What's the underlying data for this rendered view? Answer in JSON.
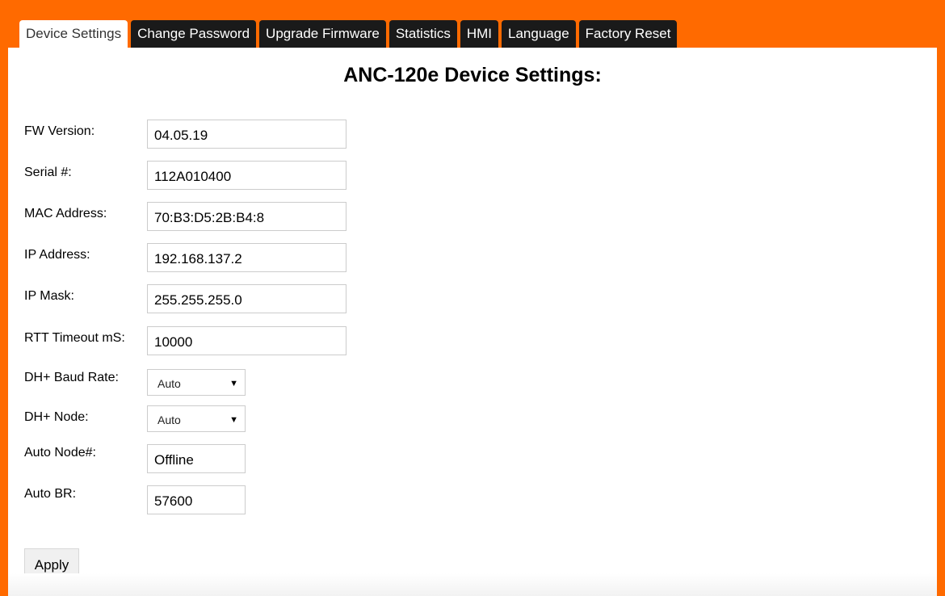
{
  "tabs": [
    {
      "label": "Device Settings",
      "active": true
    },
    {
      "label": "Change Password",
      "active": false
    },
    {
      "label": "Upgrade Firmware",
      "active": false
    },
    {
      "label": "Statistics",
      "active": false
    },
    {
      "label": "HMI",
      "active": false
    },
    {
      "label": "Language",
      "active": false
    },
    {
      "label": "Factory Reset",
      "active": false
    }
  ],
  "page_title": "ANC-120e Device Settings:",
  "fields": {
    "fw_version": {
      "label": "FW Version:",
      "value": "04.05.19"
    },
    "serial": {
      "label": "Serial #:",
      "value": "112A010400"
    },
    "mac": {
      "label": "MAC Address:",
      "value": "70:B3:D5:2B:B4:8"
    },
    "ip": {
      "label": "IP Address:",
      "value": "192.168.137.2"
    },
    "mask": {
      "label": "IP Mask:",
      "value": "255.255.255.0"
    },
    "rtt": {
      "label": "RTT Timeout mS:",
      "value": "10000"
    },
    "baud": {
      "label": "DH+ Baud Rate:",
      "value": "Auto"
    },
    "node": {
      "label": "DH+ Node:",
      "value": "Auto"
    },
    "auto_node": {
      "label": "Auto Node#:",
      "value": "Offline"
    },
    "auto_br": {
      "label": "Auto BR:",
      "value": "57600"
    }
  },
  "apply_label": "Apply",
  "colors": {
    "frame": "#ff6a00",
    "tab_bg": "#1a1a1a",
    "panel": "#ffffff"
  },
  "icons": {
    "dropdown": "chevron-down-icon"
  }
}
